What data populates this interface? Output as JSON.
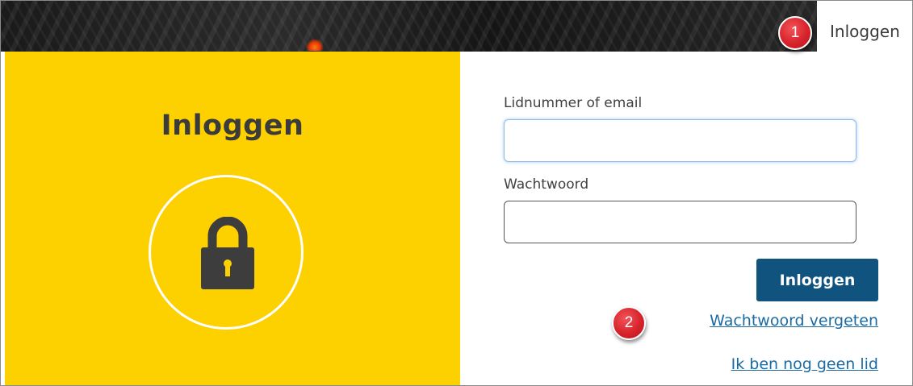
{
  "header": {
    "tab_label": "Inloggen"
  },
  "callouts": {
    "first": "1",
    "second": "2"
  },
  "panel": {
    "title": "Inloggen",
    "icon": "lock-icon"
  },
  "form": {
    "username_label": "Lidnummer of email",
    "username_value": "",
    "password_label": "Wachtwoord",
    "password_value": "",
    "submit_label": "Inloggen",
    "forgot_password_link": "Wachtwoord vergeten",
    "register_link": "Ik ben nog geen lid"
  },
  "colors": {
    "panel_yellow": "#fdd000",
    "button_blue": "#10537f",
    "link_blue": "#1b6aa2",
    "badge_red": "#d8232b"
  }
}
